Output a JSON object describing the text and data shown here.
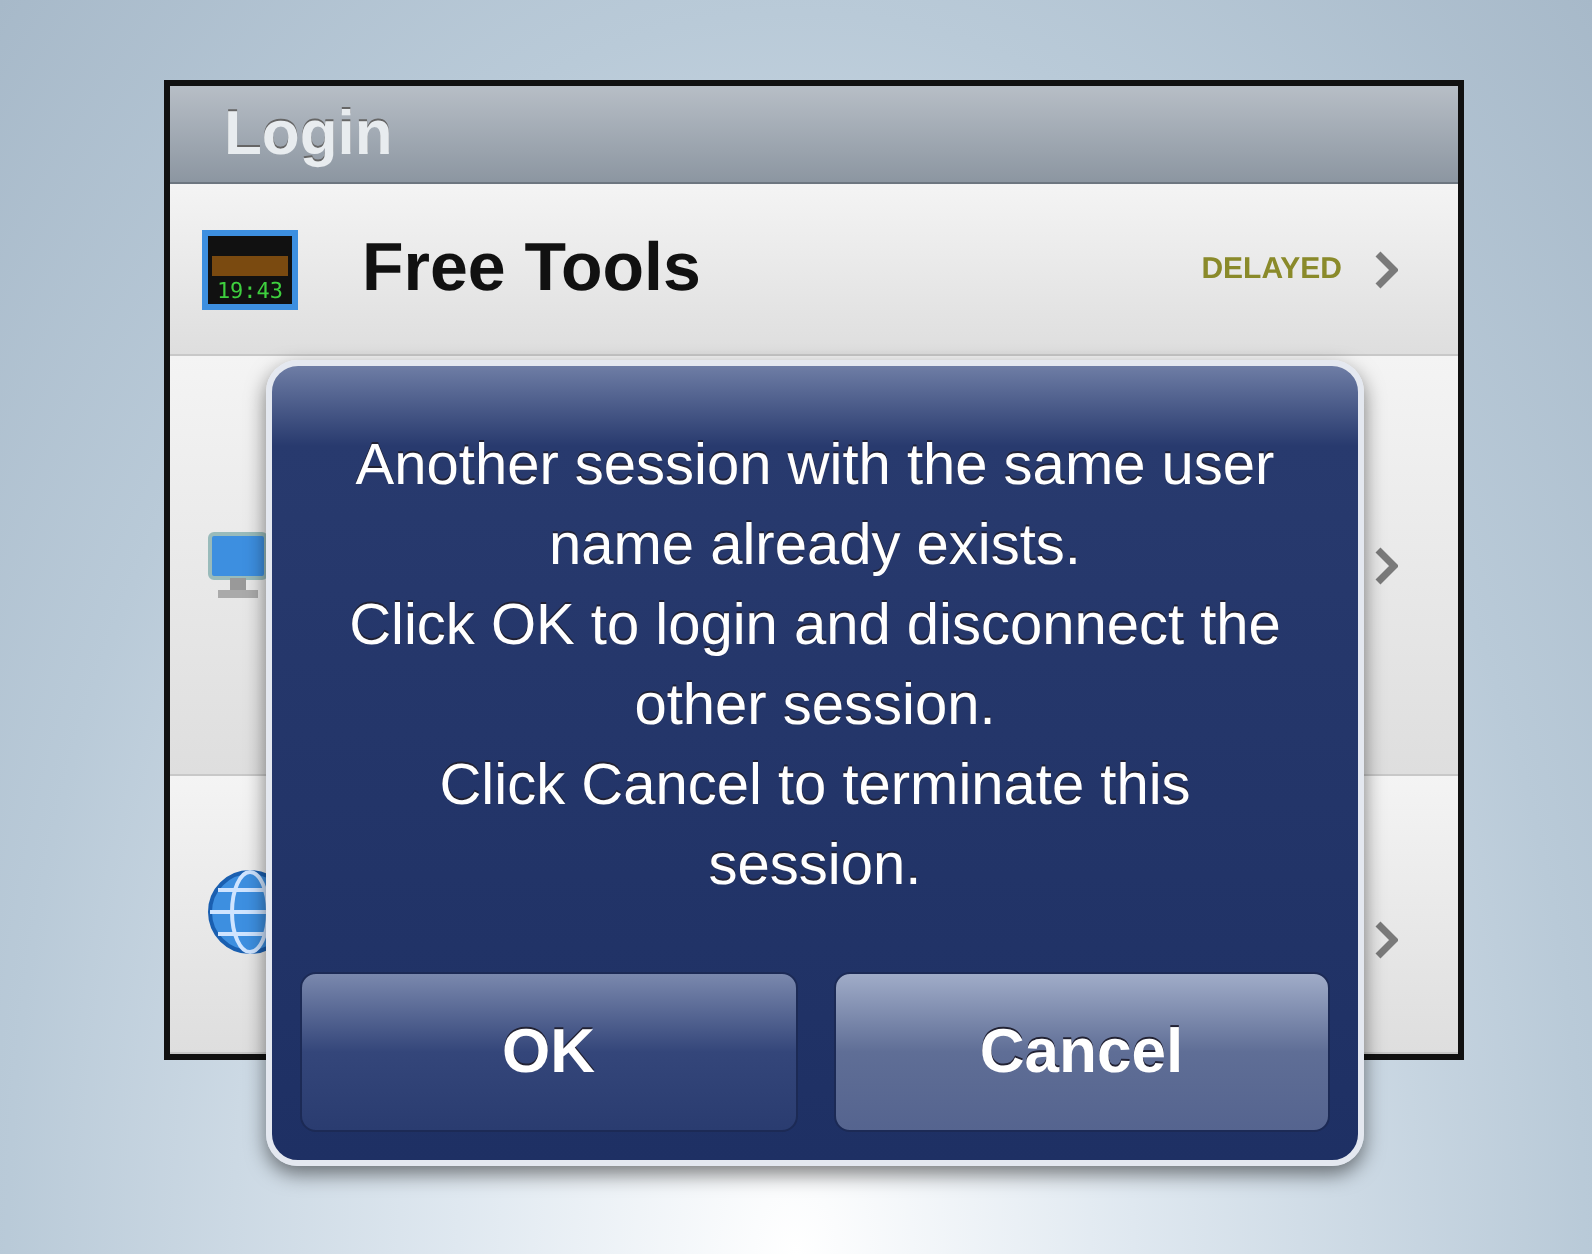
{
  "nav_bar": {
    "title": "Login"
  },
  "rows": [
    {
      "kind": "tools",
      "title": "Free Tools",
      "badge": "DELAYED",
      "icon_text": "19:43"
    },
    {
      "kind": "login"
    },
    {
      "kind": "demo"
    }
  ],
  "alert": {
    "message_lines": [
      "Another session with the same user name already exists.",
      "Click OK to login and disconnect the other session.",
      "Click Cancel to terminate this session."
    ],
    "buttons": [
      {
        "label": "OK",
        "selected": false
      },
      {
        "label": "Cancel",
        "selected": true
      }
    ]
  }
}
